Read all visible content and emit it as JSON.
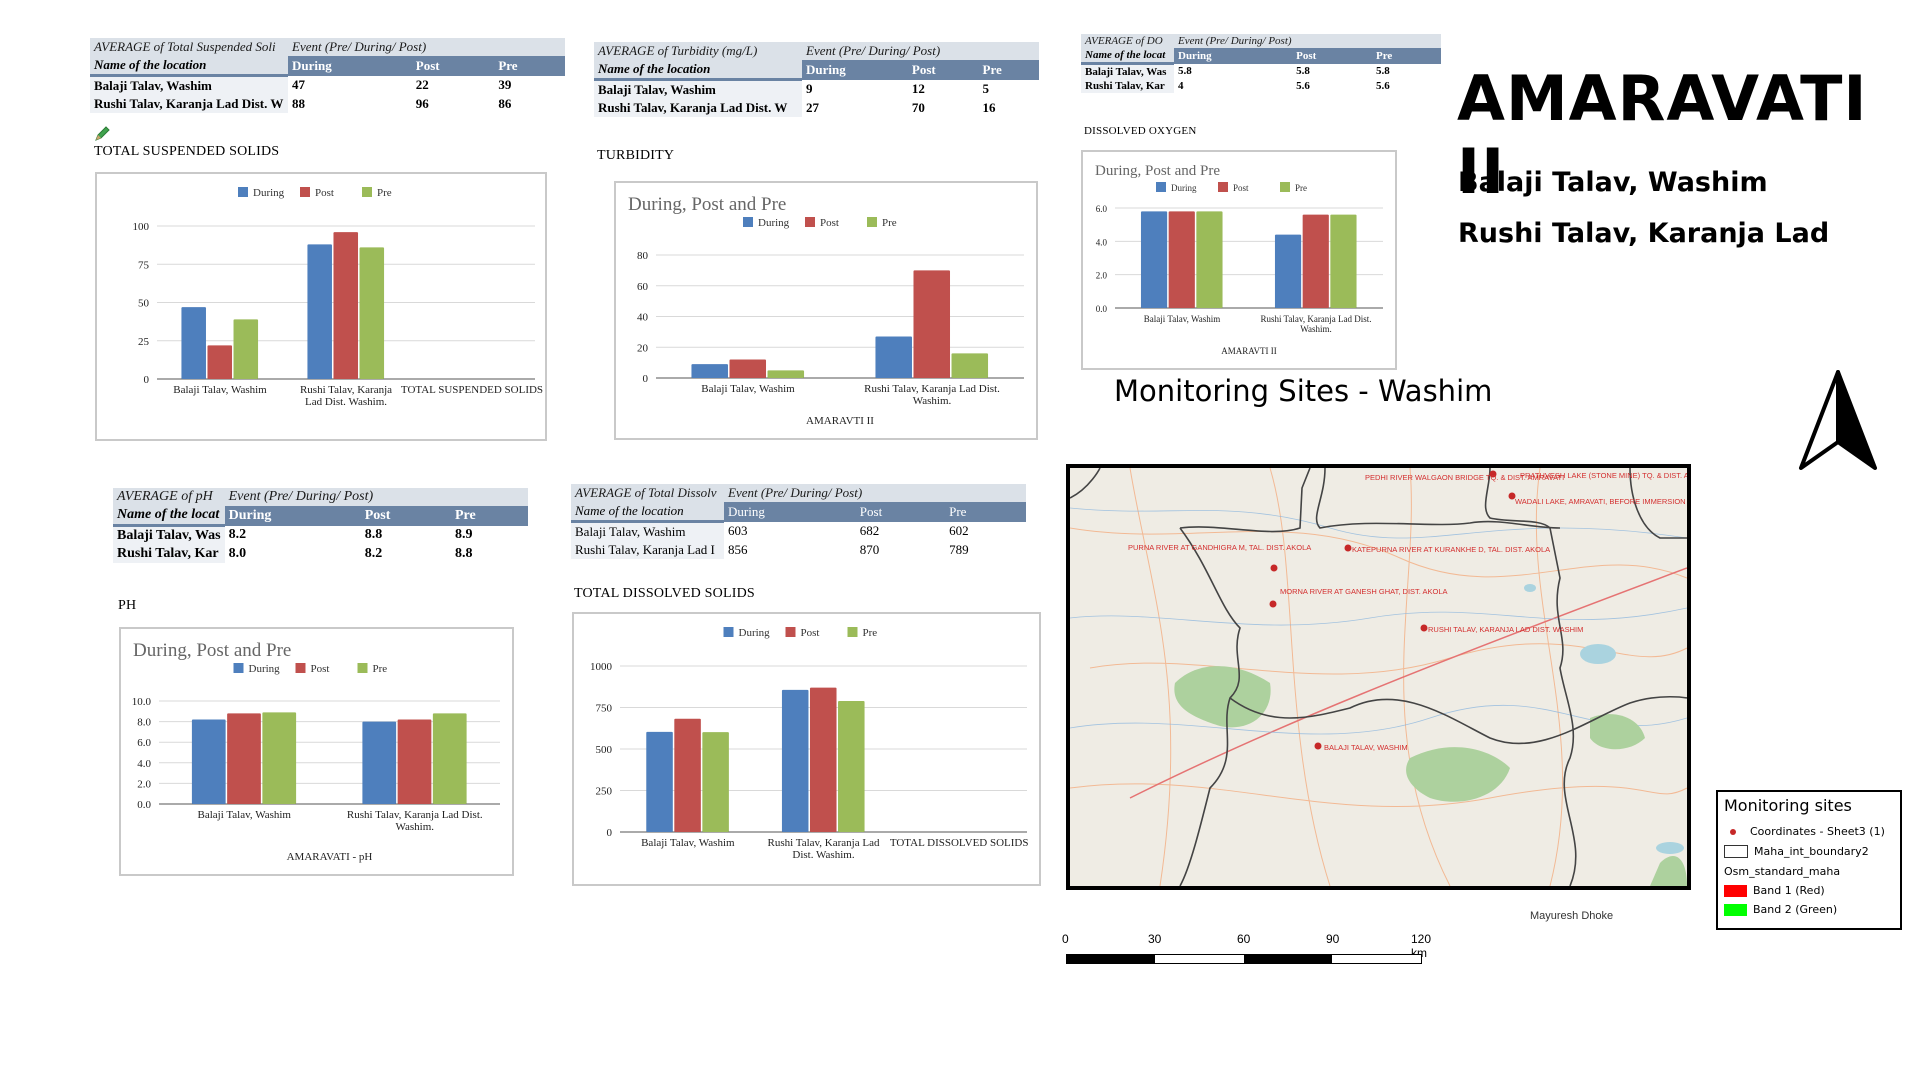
{
  "colors": {
    "during": "#4e7fbd",
    "post": "#c0504d",
    "pre": "#9bbb59",
    "table_header": "#6a83a3",
    "table_caption": "#dbe1e8",
    "marker": "#c62828"
  },
  "page": {
    "title": "AMARAVATI II",
    "sites": [
      "Balaji Talav, Washim",
      "Rushi Talav, Karanja Lad"
    ]
  },
  "tables": {
    "tss": {
      "caption": "AVERAGE of Total Suspended Soli",
      "event_label": "Event (Pre/ During/ Post)",
      "name_header": "Name of the location",
      "columns": [
        "During",
        "Post",
        "Pre"
      ],
      "rows": [
        {
          "name": "Balaji Talav, Washim",
          "values": [
            "47",
            "22",
            "39"
          ]
        },
        {
          "name": "Rushi Talav, Karanja Lad Dist. W",
          "values": [
            "88",
            "96",
            "86"
          ]
        }
      ]
    },
    "turbidity": {
      "caption": "AVERAGE of Turbidity (mg/L)",
      "event_label": "Event (Pre/ During/ Post)",
      "name_header": "Name of the location",
      "columns": [
        "During",
        "Post",
        "Pre"
      ],
      "rows": [
        {
          "name": "Balaji Talav, Washim",
          "values": [
            "9",
            "12",
            "5"
          ]
        },
        {
          "name": "Rushi Talav, Karanja Lad Dist. W",
          "values": [
            "27",
            "70",
            "16"
          ]
        }
      ]
    },
    "do": {
      "caption": "AVERAGE of DO",
      "event_label": "Event (Pre/ During/ Post)",
      "name_header": "Name of the locat",
      "columns": [
        "During",
        "Post",
        "Pre"
      ],
      "rows": [
        {
          "name": "Balaji Talav, Was",
          "values": [
            "5.8",
            "5.8",
            "5.8"
          ]
        },
        {
          "name": "Rushi Talav, Kar",
          "values": [
            "4",
            "5.6",
            "5.6"
          ]
        }
      ]
    },
    "ph": {
      "caption": "AVERAGE of pH",
      "event_label": "Event (Pre/ During/ Post)",
      "name_header": "Name of the locat",
      "columns": [
        "During",
        "Post",
        "Pre"
      ],
      "rows": [
        {
          "name": "Balaji Talav, Was",
          "values": [
            "8.2",
            "8.8",
            "8.9"
          ]
        },
        {
          "name": "Rushi Talav, Kar",
          "values": [
            "8.0",
            "8.2",
            "8.8"
          ]
        }
      ]
    },
    "tds": {
      "caption": "AVERAGE of Total Dissolv",
      "event_label": "Event (Pre/ During/ Post)",
      "name_header": "Name of the location",
      "columns": [
        "During",
        "Post",
        "Pre"
      ],
      "rows": [
        {
          "name": "Balaji Talav, Washim",
          "values": [
            "603",
            "682",
            "602"
          ]
        },
        {
          "name": "Rushi Talav, Karanja Lad I",
          "values": [
            "856",
            "870",
            "789"
          ]
        }
      ]
    }
  },
  "section_labels": {
    "tss": "TOTAL SUSPENDED SOLIDS",
    "turbidity": "TURBIDITY",
    "do": "DISSOLVED OXYGEN",
    "ph": "PH",
    "tds": "TOTAL DISSOLVED SOLIDS"
  },
  "chart_data": [
    {
      "id": "tss",
      "type": "bar",
      "title": "",
      "legend": [
        "During",
        "Post",
        "Pre"
      ],
      "legend_position": "top",
      "categories": [
        "Balaji Talav, Washim",
        "Rushi Talav, Karanja Lad Dist. Washim.",
        "TOTAL SUSPENDED SOLIDS"
      ],
      "series": [
        {
          "name": "During",
          "values": [
            47,
            88,
            null
          ]
        },
        {
          "name": "Post",
          "values": [
            22,
            96,
            null
          ]
        },
        {
          "name": "Pre",
          "values": [
            39,
            86,
            null
          ]
        }
      ],
      "yticks": [
        "0",
        "25",
        "50",
        "75",
        "100"
      ],
      "ylim": [
        0,
        100
      ],
      "xlabel": "",
      "ylabel": "",
      "grid": true
    },
    {
      "id": "turbidity",
      "type": "bar",
      "title": "During, Post and Pre",
      "legend": [
        "During",
        "Post",
        "Pre"
      ],
      "legend_position": "top",
      "categories": [
        "Balaji Talav, Washim",
        "Rushi Talav, Karanja Lad Dist. Washim."
      ],
      "series": [
        {
          "name": "During",
          "values": [
            9,
            27
          ]
        },
        {
          "name": "Post",
          "values": [
            12,
            70
          ]
        },
        {
          "name": "Pre",
          "values": [
            5,
            16
          ]
        }
      ],
      "yticks": [
        "0",
        "20",
        "40",
        "60",
        "80"
      ],
      "ylim": [
        0,
        80
      ],
      "xlabel": "AMARAVTI II",
      "ylabel": "",
      "grid": true
    },
    {
      "id": "do",
      "type": "bar",
      "title": "During, Post and Pre",
      "legend": [
        "During",
        "Post",
        "Pre"
      ],
      "legend_position": "top",
      "categories": [
        "Balaji Talav, Washim",
        "Rushi Talav, Karanja Lad Dist. Washim."
      ],
      "series": [
        {
          "name": "During",
          "values": [
            5.8,
            4.4
          ]
        },
        {
          "name": "Post",
          "values": [
            5.8,
            5.6
          ]
        },
        {
          "name": "Pre",
          "values": [
            5.8,
            5.6
          ]
        }
      ],
      "yticks": [
        "0.0",
        "2.0",
        "4.0",
        "6.0"
      ],
      "ylim": [
        0,
        6
      ],
      "xlabel": "AMARAVTI II",
      "ylabel": "",
      "grid": true
    },
    {
      "id": "ph",
      "type": "bar",
      "title": "During, Post and Pre",
      "legend": [
        "During",
        "Post",
        "Pre"
      ],
      "legend_position": "top",
      "categories": [
        "Balaji Talav, Washim",
        "Rushi Talav, Karanja Lad Dist. Washim."
      ],
      "series": [
        {
          "name": "During",
          "values": [
            8.2,
            8.0
          ]
        },
        {
          "name": "Post",
          "values": [
            8.8,
            8.2
          ]
        },
        {
          "name": "Pre",
          "values": [
            8.9,
            8.8
          ]
        }
      ],
      "yticks": [
        "0.0",
        "2.0",
        "4.0",
        "6.0",
        "8.0",
        "10.0"
      ],
      "ylim": [
        0,
        10
      ],
      "xlabel": "AMARAVATI - pH",
      "ylabel": "",
      "grid": true
    },
    {
      "id": "tds",
      "type": "bar",
      "title": "",
      "legend": [
        "During",
        "Post",
        "Pre"
      ],
      "legend_position": "top",
      "categories": [
        "Balaji Talav, Washim",
        "Rushi Talav, Karanja Lad Dist. Washim.",
        "TOTAL DISSOLVED SOLIDS"
      ],
      "series": [
        {
          "name": "During",
          "values": [
            603,
            856,
            null
          ]
        },
        {
          "name": "Post",
          "values": [
            682,
            870,
            null
          ]
        },
        {
          "name": "Pre",
          "values": [
            602,
            789,
            null
          ]
        }
      ],
      "yticks": [
        "0",
        "250",
        "500",
        "750",
        "1000"
      ],
      "ylim": [
        0,
        1000
      ],
      "xlabel": "",
      "ylabel": "",
      "grid": true
    }
  ],
  "map": {
    "title": "Monitoring Sites - Washim",
    "labels": [
      "PEDHI RIVER WALGAON BRIDGE TQ. & DIST. AMRAVATI",
      "PRATHVESH LAKE (STONE MINE) TQ. & DIST. AMRAVATI",
      "WADALI LAKE, AMRAVATI, BEFORE IMMERSION",
      "PURNA RIVER AT GANDHIGRA M, TAL. DIST. AKOLA",
      "KATEPURNA RIVER AT KURANKHE D, TAL. DIST. AKOLA",
      "MORNA RIVER AT GANESH GHAT, DIST. AKOLA",
      "RUSHI TALAV, KARANJA LAD DIST. WASHIM",
      "BALAJI TALAV, WASHIM"
    ],
    "author": "Mayuresh Dhoke",
    "scale": [
      "0",
      "30",
      "60",
      "90",
      "120 km"
    ]
  },
  "legend": {
    "title": "Monitoring sites",
    "items": [
      {
        "label": "Coordinates - Sheet3 (1)",
        "swatch": "dot"
      },
      {
        "label": "Maha_int_boundary2",
        "swatch": "box"
      },
      {
        "label": "Osm_standard_maha",
        "swatch": "none"
      },
      {
        "label": "Band 1 (Red)",
        "swatch": "#ff0000"
      },
      {
        "label": "Band 2 (Green)",
        "swatch": "#00ff00"
      }
    ]
  }
}
